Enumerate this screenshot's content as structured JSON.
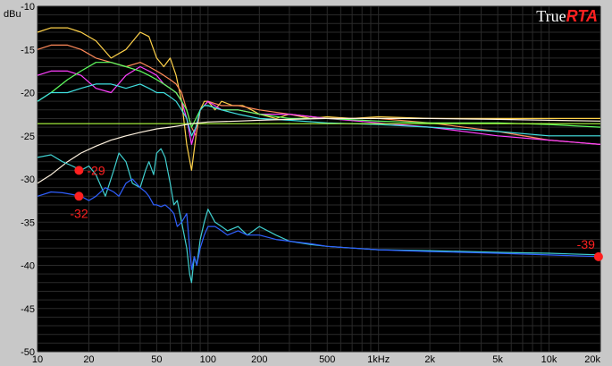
{
  "brand": {
    "prefix": "True",
    "accent": "RTA"
  },
  "colors": {
    "background": "#000000",
    "frame": "#c8c8c8",
    "grid": "#2a2a2a",
    "marker": "#ff2020"
  },
  "chart_data": {
    "type": "line",
    "x_scale": "log",
    "xlim": [
      10,
      20000
    ],
    "ylim": [
      -50,
      -10
    ],
    "ylabel": "dBu",
    "grid": true,
    "x_ticks": [
      {
        "value": 10,
        "label": "10"
      },
      {
        "value": 20,
        "label": "20"
      },
      {
        "value": 50,
        "label": "50"
      },
      {
        "value": 100,
        "label": "100"
      },
      {
        "value": 200,
        "label": "200"
      },
      {
        "value": 500,
        "label": "500"
      },
      {
        "value": 1000,
        "label": "1kHz"
      },
      {
        "value": 2000,
        "label": "2k"
      },
      {
        "value": 5000,
        "label": "5k"
      },
      {
        "value": 10000,
        "label": "10k"
      },
      {
        "value": 20000,
        "label": "20k"
      }
    ],
    "y_ticks": [
      {
        "value": -10,
        "label": "-10"
      },
      {
        "value": -15,
        "label": "-15"
      },
      {
        "value": -20,
        "label": "-20"
      },
      {
        "value": -25,
        "label": "-25"
      },
      {
        "value": -30,
        "label": "-30"
      },
      {
        "value": -35,
        "label": "-35"
      },
      {
        "value": -40,
        "label": "-40"
      },
      {
        "value": -45,
        "label": "-45"
      },
      {
        "value": -50,
        "label": "-50"
      }
    ],
    "series": [
      {
        "color": "#ffd24a",
        "x": [
          10,
          12,
          15,
          18,
          22,
          27,
          33,
          40,
          45,
          50,
          55,
          60,
          65,
          70,
          75,
          80,
          85,
          90,
          95,
          100,
          110,
          120,
          140,
          160,
          180,
          200,
          250,
          300,
          400,
          500,
          700,
          1000,
          2000,
          5000,
          10000,
          20000
        ],
        "y": [
          -13,
          -12.5,
          -12.5,
          -13,
          -14,
          -16,
          -15,
          -13,
          -13.5,
          -16,
          -17,
          -16,
          -18,
          -21,
          -26,
          -29,
          -25,
          -22,
          -21,
          -21,
          -22,
          -21,
          -21.5,
          -21.5,
          -22,
          -22.5,
          -23,
          -22.5,
          -23,
          -22.8,
          -23,
          -22.8,
          -23,
          -23,
          -23,
          -23
        ]
      },
      {
        "color": "#ff8a5a",
        "x": [
          10,
          12,
          15,
          18,
          22,
          27,
          33,
          40,
          45,
          50,
          55,
          60,
          65,
          70,
          75,
          80,
          85,
          90,
          95,
          100,
          120,
          150,
          200,
          300,
          500,
          1000,
          2000,
          5000,
          10000,
          20000
        ],
        "y": [
          -15,
          -14.5,
          -14.5,
          -15,
          -16,
          -16.5,
          -17,
          -16.5,
          -17,
          -17.5,
          -18,
          -18.5,
          -19,
          -20,
          -22,
          -24,
          -25,
          -22,
          -21.5,
          -21,
          -21.5,
          -21.5,
          -22,
          -22.5,
          -23,
          -23,
          -23.5,
          -24.5,
          -25.5,
          -26
        ]
      },
      {
        "color": "#ff40ff",
        "x": [
          10,
          12,
          15,
          18,
          22,
          27,
          33,
          40,
          45,
          50,
          55,
          60,
          65,
          70,
          75,
          80,
          85,
          90,
          95,
          100,
          120,
          150,
          200,
          300,
          500,
          1000,
          2000,
          5000,
          10000,
          20000
        ],
        "y": [
          -18,
          -17.5,
          -17.5,
          -18,
          -19.5,
          -20,
          -18,
          -17,
          -17.5,
          -18,
          -19,
          -19.5,
          -20,
          -21,
          -23,
          -26,
          -24,
          -22,
          -21.5,
          -21,
          -22,
          -22,
          -22.5,
          -22.5,
          -23,
          -23.5,
          -24,
          -25,
          -25.5,
          -26
        ]
      },
      {
        "color": "#60ff60",
        "x": [
          10,
          12,
          15,
          18,
          22,
          27,
          33,
          40,
          45,
          50,
          55,
          60,
          65,
          70,
          75,
          80,
          85,
          90,
          95,
          100,
          120,
          150,
          200,
          300,
          500,
          1000,
          2000,
          5000,
          10000,
          20000
        ],
        "y": [
          -21,
          -20,
          -18.5,
          -17.5,
          -16.5,
          -16.5,
          -17,
          -17.5,
          -18,
          -18.5,
          -19,
          -19.5,
          -20,
          -21,
          -22,
          -24,
          -23,
          -22,
          -21.5,
          -21.5,
          -22,
          -22,
          -22.5,
          -23,
          -23,
          -23.3,
          -23.5,
          -23.5,
          -23.7,
          -24
        ]
      },
      {
        "color": "#40e0e0",
        "x": [
          10,
          12,
          15,
          18,
          22,
          27,
          33,
          40,
          45,
          50,
          55,
          60,
          65,
          70,
          75,
          80,
          85,
          90,
          95,
          100,
          120,
          150,
          200,
          300,
          500,
          1000,
          2000,
          5000,
          10000,
          20000
        ],
        "y": [
          -21,
          -20,
          -20,
          -19.5,
          -19,
          -19,
          -19.5,
          -19,
          -19.5,
          -20,
          -20,
          -20.5,
          -21,
          -22,
          -23,
          -25,
          -24,
          -22,
          -21.5,
          -21.5,
          -22,
          -22.5,
          -23,
          -23.2,
          -23.5,
          -23.7,
          -24,
          -24.5,
          -25,
          -25
        ]
      },
      {
        "color": "#b0ff40",
        "x": [
          10,
          20,
          30,
          50,
          100,
          200,
          500,
          1000,
          2000,
          5000,
          10000,
          20000
        ],
        "y": [
          -23.6,
          -23.6,
          -23.6,
          -23.6,
          -23.6,
          -23.6,
          -23.6,
          -23.6,
          -23.6,
          -23.6,
          -23.6,
          -23.6
        ]
      },
      {
        "color": "#fff3e0",
        "x": [
          10,
          12,
          15,
          18,
          22,
          27,
          33,
          40,
          50,
          60,
          70,
          80,
          100,
          150,
          200,
          300,
          500,
          1000,
          2000,
          5000,
          10000,
          20000
        ],
        "y": [
          -30.5,
          -29.5,
          -28,
          -27,
          -26.2,
          -25.5,
          -25,
          -24.6,
          -24.2,
          -24,
          -23.8,
          -23.6,
          -23.4,
          -23.3,
          -23.2,
          -23.1,
          -23,
          -23,
          -23,
          -23.1,
          -23.2,
          -23.3
        ]
      },
      {
        "color": "#40d0d0",
        "x": [
          10,
          12,
          14,
          16,
          18,
          20,
          22,
          25,
          28,
          30,
          33,
          36,
          40,
          43,
          45,
          48,
          50,
          53,
          56,
          60,
          63,
          66,
          70,
          75,
          78,
          80,
          83,
          86,
          90,
          95,
          100,
          110,
          120,
          130,
          150,
          170,
          200,
          250,
          300,
          400,
          500,
          700,
          1000,
          2000,
          5000,
          10000,
          20000
        ],
        "y": [
          -27.5,
          -27.2,
          -28,
          -28.5,
          -29,
          -28.5,
          -29.5,
          -32,
          -29,
          -27,
          -28,
          -30.5,
          -31,
          -29,
          -28,
          -29.5,
          -27,
          -26.5,
          -27.5,
          -30.5,
          -33,
          -32.5,
          -35,
          -38,
          -41,
          -42,
          -39,
          -40,
          -37,
          -35,
          -33.5,
          -35,
          -35.5,
          -36,
          -35.5,
          -36.5,
          -35.5,
          -36.5,
          -37.2,
          -37.6,
          -37.8,
          -38,
          -38.2,
          -38.3,
          -38.5,
          -38.6,
          -38.8
        ]
      },
      {
        "color": "#3060ff",
        "x": [
          10,
          12,
          14,
          16,
          18,
          20,
          22,
          25,
          28,
          30,
          33,
          36,
          40,
          43,
          45,
          48,
          50,
          53,
          56,
          60,
          63,
          66,
          70,
          75,
          78,
          80,
          83,
          86,
          90,
          95,
          100,
          110,
          120,
          130,
          150,
          170,
          200,
          250,
          300,
          400,
          500,
          700,
          1000,
          2000,
          5000,
          10000,
          20000
        ],
        "y": [
          -32,
          -31.5,
          -31.6,
          -31.8,
          -32,
          -32.5,
          -32,
          -31,
          -31.5,
          -32,
          -30.5,
          -30,
          -31,
          -31.5,
          -32,
          -33,
          -33,
          -33.2,
          -33,
          -33.5,
          -34,
          -35.5,
          -35,
          -34,
          -38,
          -40.5,
          -39,
          -40,
          -38,
          -36.5,
          -35.5,
          -35.5,
          -36,
          -36.5,
          -36,
          -36.5,
          -36.5,
          -37,
          -37.2,
          -37.5,
          -37.8,
          -38,
          -38.2,
          -38.4,
          -38.6,
          -38.8,
          -39
        ]
      }
    ],
    "annotations": [
      {
        "x": 17.5,
        "y": -29,
        "label": "-29",
        "label_side": "right"
      },
      {
        "x": 17.5,
        "y": -32,
        "label": "-32",
        "label_side": "below"
      },
      {
        "x": 19500,
        "y": -39,
        "label": "-39",
        "label_side": "above-left"
      }
    ]
  }
}
